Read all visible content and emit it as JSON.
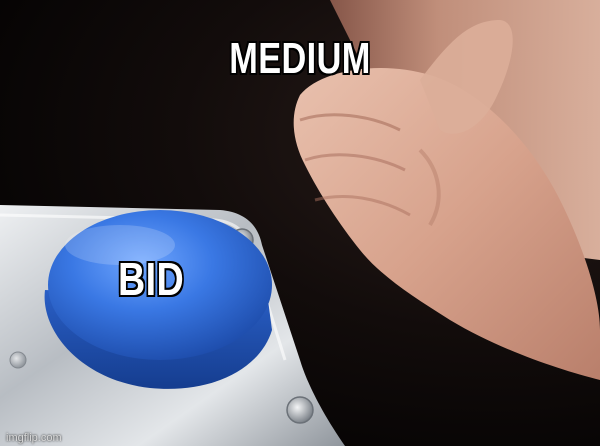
{
  "meme": {
    "template": "Blank Nut Button",
    "top_caption": "MEDIUM",
    "button_caption": "BID",
    "watermark": "imgflip.com"
  },
  "colors": {
    "background": "#050303",
    "button_blue": "#2f6fdc",
    "skin": "#d9a893",
    "metal": "#c9cdd2",
    "caption_text": "#ffffff",
    "caption_outline": "#000000"
  }
}
